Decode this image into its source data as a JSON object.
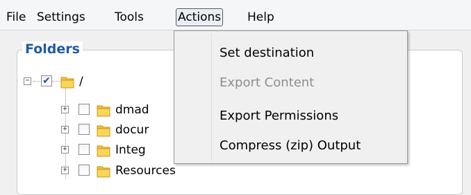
{
  "menubar": {
    "file": "File",
    "settings": "Settings",
    "tools": "Tools",
    "actions": "Actions",
    "help": "Help"
  },
  "folders": {
    "title": "Folders",
    "root": {
      "label": "/",
      "checked": true
    },
    "items": [
      {
        "label": "dmad"
      },
      {
        "label": "docur"
      },
      {
        "label": "Integ"
      },
      {
        "label": "Resources"
      }
    ]
  },
  "actions_menu": {
    "items": [
      {
        "label": "Set destination",
        "enabled": true
      },
      {
        "label": "Export Content",
        "enabled": false
      },
      {
        "label": "Export Permissions",
        "enabled": true
      },
      {
        "label": "Compress (zip) Output",
        "enabled": true
      }
    ]
  },
  "colors": {
    "title_blue": "#1f5aa6",
    "folder_yellow": "#f2c12e",
    "disabled_gray": "#8d8d8d"
  }
}
